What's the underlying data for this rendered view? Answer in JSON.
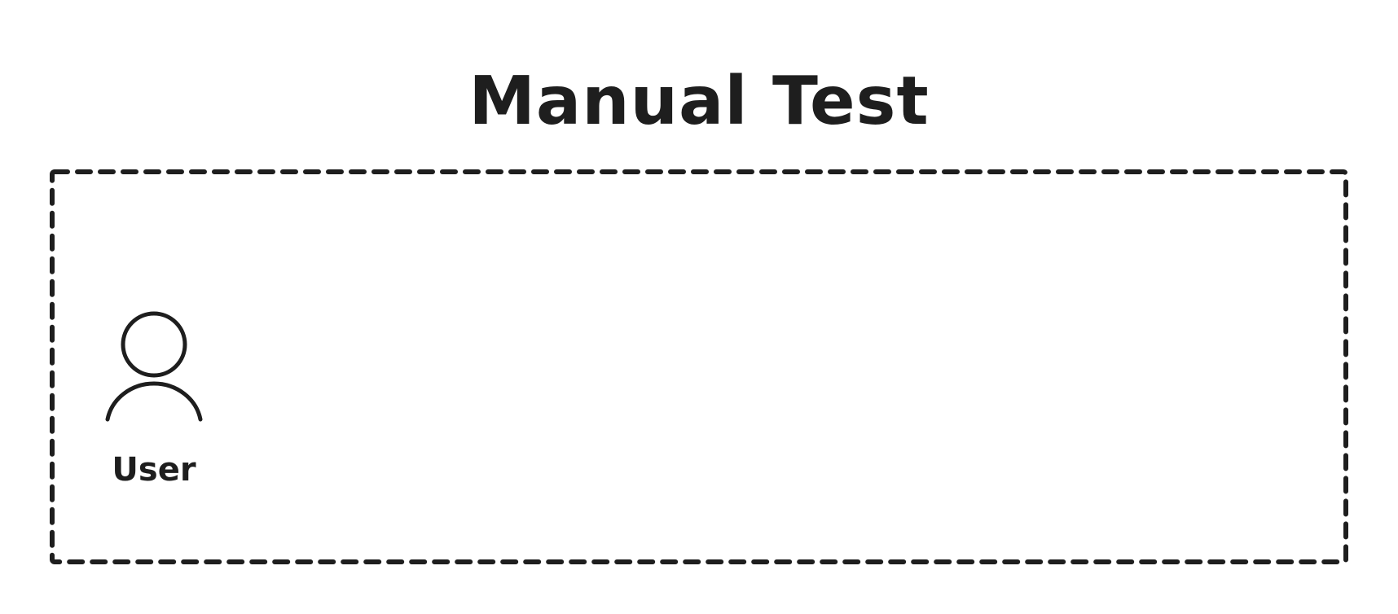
{
  "diagram": {
    "title": "Manual Test",
    "actor": {
      "label": "User",
      "icon": "user-icon"
    }
  },
  "colors": {
    "stroke": "#1e1e1e",
    "background": "#ffffff"
  }
}
